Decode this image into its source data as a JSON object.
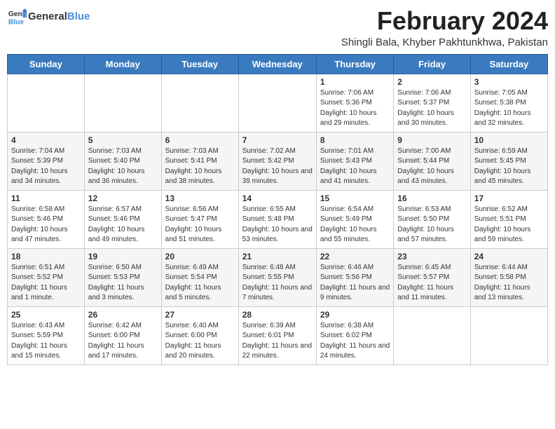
{
  "header": {
    "logo_general": "General",
    "logo_blue": "Blue",
    "title": "February 2024",
    "subtitle": "Shingli Bala, Khyber Pakhtunkhwa, Pakistan"
  },
  "days_of_week": [
    "Sunday",
    "Monday",
    "Tuesday",
    "Wednesday",
    "Thursday",
    "Friday",
    "Saturday"
  ],
  "weeks": [
    [
      {
        "day": "",
        "info": ""
      },
      {
        "day": "",
        "info": ""
      },
      {
        "day": "",
        "info": ""
      },
      {
        "day": "",
        "info": ""
      },
      {
        "day": "1",
        "info": "Sunrise: 7:06 AM\nSunset: 5:36 PM\nDaylight: 10 hours and 29 minutes."
      },
      {
        "day": "2",
        "info": "Sunrise: 7:06 AM\nSunset: 5:37 PM\nDaylight: 10 hours and 30 minutes."
      },
      {
        "day": "3",
        "info": "Sunrise: 7:05 AM\nSunset: 5:38 PM\nDaylight: 10 hours and 32 minutes."
      }
    ],
    [
      {
        "day": "4",
        "info": "Sunrise: 7:04 AM\nSunset: 5:39 PM\nDaylight: 10 hours and 34 minutes."
      },
      {
        "day": "5",
        "info": "Sunrise: 7:03 AM\nSunset: 5:40 PM\nDaylight: 10 hours and 36 minutes."
      },
      {
        "day": "6",
        "info": "Sunrise: 7:03 AM\nSunset: 5:41 PM\nDaylight: 10 hours and 38 minutes."
      },
      {
        "day": "7",
        "info": "Sunrise: 7:02 AM\nSunset: 5:42 PM\nDaylight: 10 hours and 39 minutes."
      },
      {
        "day": "8",
        "info": "Sunrise: 7:01 AM\nSunset: 5:43 PM\nDaylight: 10 hours and 41 minutes."
      },
      {
        "day": "9",
        "info": "Sunrise: 7:00 AM\nSunset: 5:44 PM\nDaylight: 10 hours and 43 minutes."
      },
      {
        "day": "10",
        "info": "Sunrise: 6:59 AM\nSunset: 5:45 PM\nDaylight: 10 hours and 45 minutes."
      }
    ],
    [
      {
        "day": "11",
        "info": "Sunrise: 6:58 AM\nSunset: 5:46 PM\nDaylight: 10 hours and 47 minutes."
      },
      {
        "day": "12",
        "info": "Sunrise: 6:57 AM\nSunset: 5:46 PM\nDaylight: 10 hours and 49 minutes."
      },
      {
        "day": "13",
        "info": "Sunrise: 6:56 AM\nSunset: 5:47 PM\nDaylight: 10 hours and 51 minutes."
      },
      {
        "day": "14",
        "info": "Sunrise: 6:55 AM\nSunset: 5:48 PM\nDaylight: 10 hours and 53 minutes."
      },
      {
        "day": "15",
        "info": "Sunrise: 6:54 AM\nSunset: 5:49 PM\nDaylight: 10 hours and 55 minutes."
      },
      {
        "day": "16",
        "info": "Sunrise: 6:53 AM\nSunset: 5:50 PM\nDaylight: 10 hours and 57 minutes."
      },
      {
        "day": "17",
        "info": "Sunrise: 6:52 AM\nSunset: 5:51 PM\nDaylight: 10 hours and 59 minutes."
      }
    ],
    [
      {
        "day": "18",
        "info": "Sunrise: 6:51 AM\nSunset: 5:52 PM\nDaylight: 11 hours and 1 minute."
      },
      {
        "day": "19",
        "info": "Sunrise: 6:50 AM\nSunset: 5:53 PM\nDaylight: 11 hours and 3 minutes."
      },
      {
        "day": "20",
        "info": "Sunrise: 6:49 AM\nSunset: 5:54 PM\nDaylight: 11 hours and 5 minutes."
      },
      {
        "day": "21",
        "info": "Sunrise: 6:48 AM\nSunset: 5:55 PM\nDaylight: 11 hours and 7 minutes."
      },
      {
        "day": "22",
        "info": "Sunrise: 6:46 AM\nSunset: 5:56 PM\nDaylight: 11 hours and 9 minutes."
      },
      {
        "day": "23",
        "info": "Sunrise: 6:45 AM\nSunset: 5:57 PM\nDaylight: 11 hours and 11 minutes."
      },
      {
        "day": "24",
        "info": "Sunrise: 6:44 AM\nSunset: 5:58 PM\nDaylight: 11 hours and 13 minutes."
      }
    ],
    [
      {
        "day": "25",
        "info": "Sunrise: 6:43 AM\nSunset: 5:59 PM\nDaylight: 11 hours and 15 minutes."
      },
      {
        "day": "26",
        "info": "Sunrise: 6:42 AM\nSunset: 6:00 PM\nDaylight: 11 hours and 17 minutes."
      },
      {
        "day": "27",
        "info": "Sunrise: 6:40 AM\nSunset: 6:00 PM\nDaylight: 11 hours and 20 minutes."
      },
      {
        "day": "28",
        "info": "Sunrise: 6:39 AM\nSunset: 6:01 PM\nDaylight: 11 hours and 22 minutes."
      },
      {
        "day": "29",
        "info": "Sunrise: 6:38 AM\nSunset: 6:02 PM\nDaylight: 11 hours and 24 minutes."
      },
      {
        "day": "",
        "info": ""
      },
      {
        "day": "",
        "info": ""
      }
    ]
  ]
}
